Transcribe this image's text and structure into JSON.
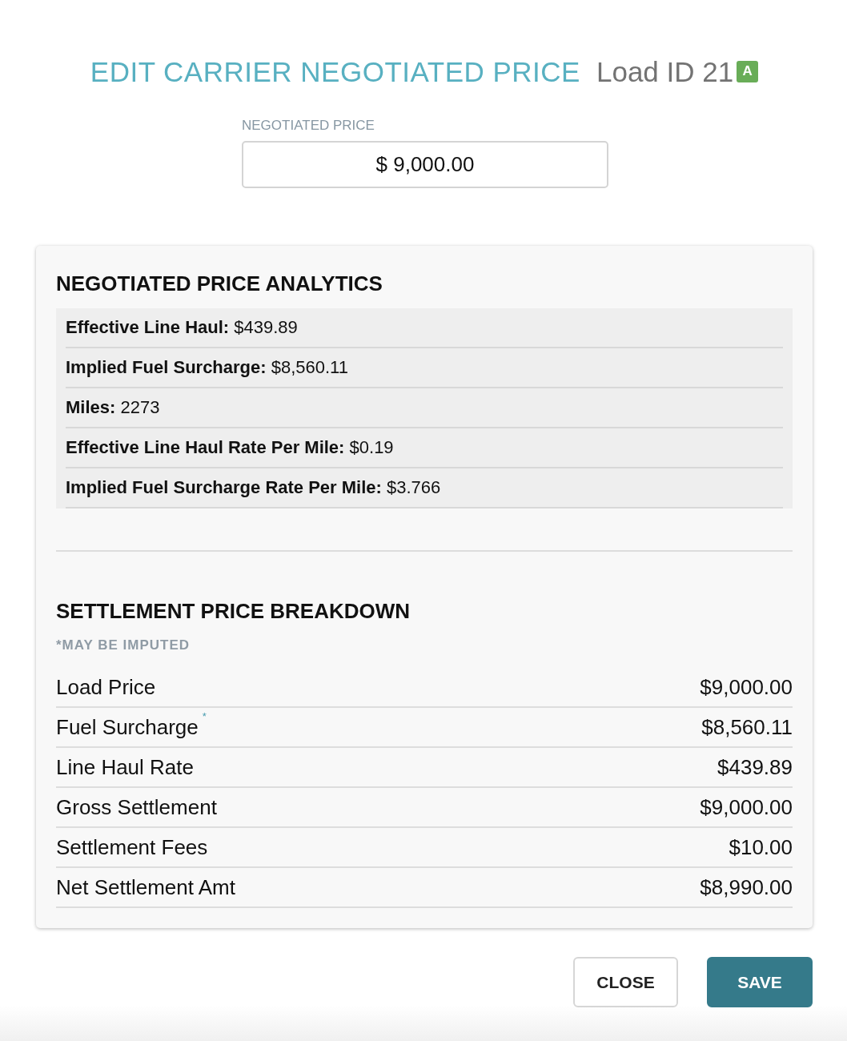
{
  "modal": {
    "title": "EDIT CARRIER NEGOTIATED PRICE",
    "load_id": "Load ID 21",
    "badge": "A"
  },
  "negotiated_price": {
    "label": "NEGOTIATED PRICE",
    "value": "$ 9,000.00"
  },
  "analytics": {
    "title": "NEGOTIATED PRICE ANALYTICS",
    "items": [
      "**Effective Line Haul:** $439.89",
      "**Implied Fuel Surcharge:** $8,560.11",
      "**Miles:** 2273",
      "**Effective Line Haul Rate Per Mile:** $0.19",
      "**Implied Fuel Surcharge Rate Per Mile:** $3.766"
    ]
  },
  "breakdown": {
    "title": "SETTLEMENT PRICE BREAKDOWN",
    "note": "*MAY BE IMPUTED",
    "rows": [
      {
        "label": "Load Price",
        "value": "$9,000.00"
      },
      {
        "label": "Fuel Surcharge",
        "marker": "*",
        "value": "$8,560.11"
      },
      {
        "label": "Line Haul Rate",
        "value": "$439.89"
      },
      {
        "label": "Gross Settlement",
        "value": "$9,000.00"
      },
      {
        "label": "Settlement Fees",
        "value": "$10.00"
      },
      {
        "label": "Net Settlement Amt",
        "value": "$8,990.00"
      }
    ]
  },
  "buttons": [
    {
      "label": "CLOSE",
      "kind": "secondary"
    },
    {
      "label": "SAVE",
      "kind": "primary"
    }
  ]
}
